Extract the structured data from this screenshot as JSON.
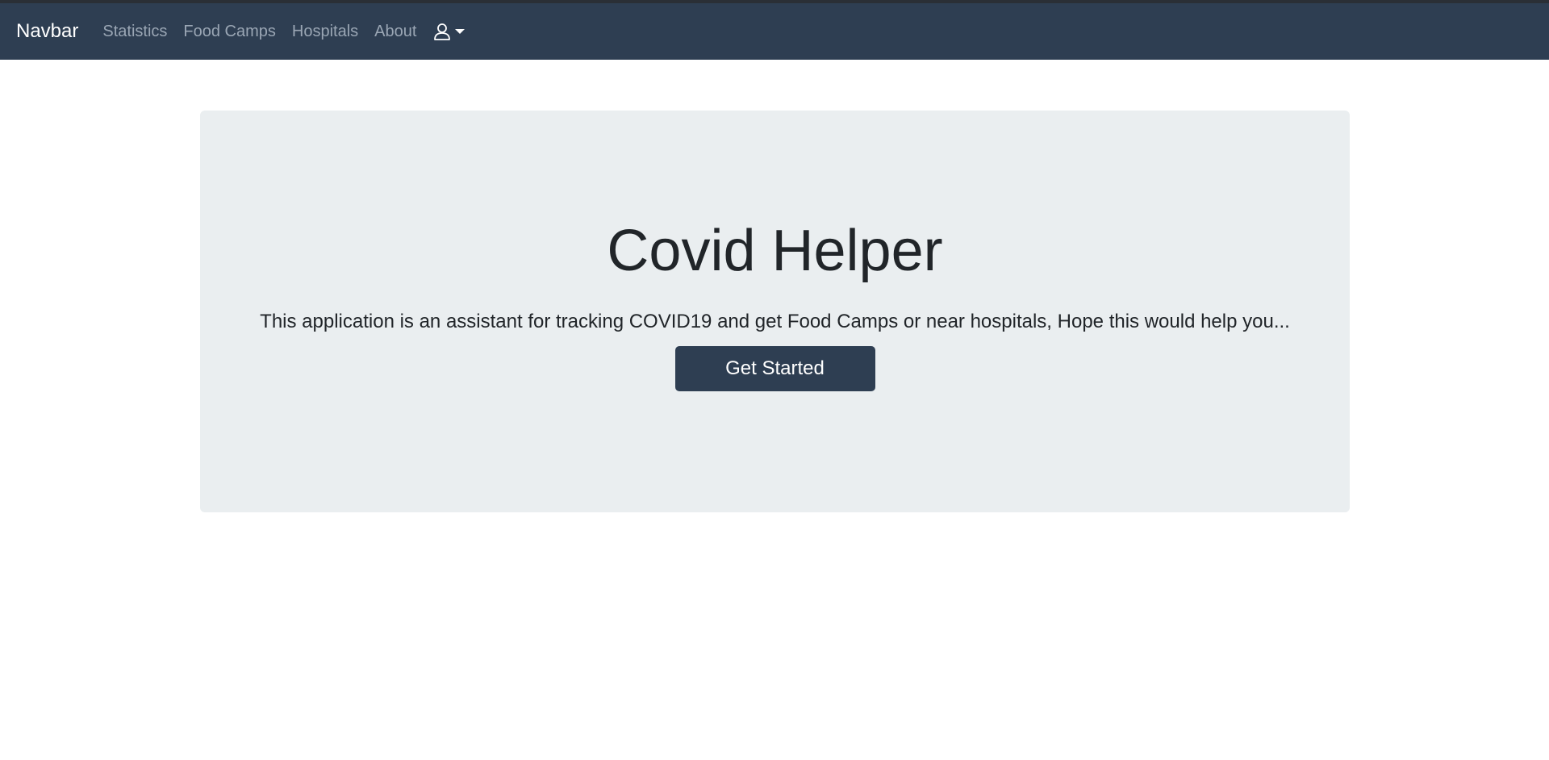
{
  "navbar": {
    "brand": "Navbar",
    "links": [
      {
        "label": "Statistics"
      },
      {
        "label": "Food Camps"
      },
      {
        "label": "Hospitals"
      },
      {
        "label": "About"
      }
    ],
    "user_icon": "user-icon",
    "dropdown_icon": "caret-down-icon"
  },
  "hero": {
    "title": "Covid Helper",
    "lead": "This application is an assistant for tracking COVID19 and get Food Camps or near hospitals, Hope this would help you...",
    "cta_label": "Get Started"
  },
  "colors": {
    "navbar_bg": "#2e3e52",
    "nav_link": "#9aa6b4",
    "jumbotron_bg": "#eaeef0",
    "button_bg": "#2e3e52",
    "text_dark": "#212529"
  }
}
